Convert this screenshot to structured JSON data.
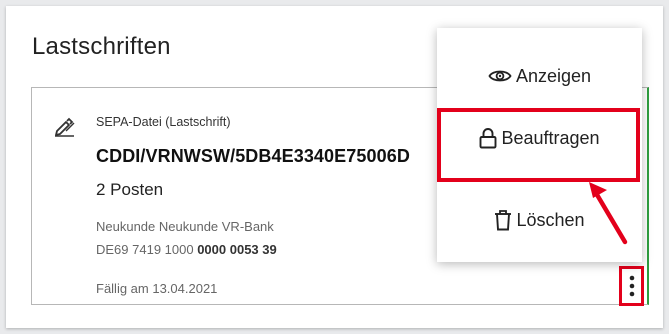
{
  "panel": {
    "title": "Lastschriften"
  },
  "card": {
    "file_type": "SEPA-Datei (Lastschrift)",
    "file_id": "CDDI/VRNWSW/5DB4E3340E75006D",
    "positions": "2 Posten",
    "payer_name": "Neukunde Neukunde VR-Bank",
    "iban_prefix": "DE69 7419 1000 ",
    "iban_bold": "0000 0053 39",
    "due": "Fällig am 13.04.2021",
    "icon": "signature-pen-icon"
  },
  "menu": {
    "items": [
      {
        "label": "Anzeigen",
        "icon": "eye-icon"
      },
      {
        "label": "Beauftragen",
        "icon": "lock-icon"
      },
      {
        "label": "Löschen",
        "icon": "trash-icon"
      }
    ]
  },
  "colors": {
    "highlight": "#e3001b",
    "accent_border": "#2f9e3f"
  }
}
